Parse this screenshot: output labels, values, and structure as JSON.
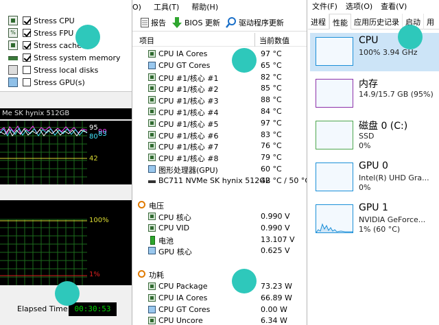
{
  "stress": {
    "items": [
      {
        "label": "Stress CPU",
        "checked": true,
        "icon": "cpu-chip-icon"
      },
      {
        "label": "Stress FPU",
        "checked": true,
        "icon": "fpu-icon"
      },
      {
        "label": "Stress cache",
        "checked": true,
        "icon": "cache-icon"
      },
      {
        "label": "Stress system memory",
        "checked": true,
        "icon": "memory-icon"
      },
      {
        "label": "Stress local disks",
        "checked": false,
        "icon": "disk-icon"
      },
      {
        "label": "Stress GPU(s)",
        "checked": false,
        "icon": "monitor-icon"
      }
    ],
    "graph_title": "Me SK hynix 512GB",
    "graph1": {
      "labels": [
        "95",
        "90",
        "80",
        "83",
        "42"
      ]
    },
    "graph2": {
      "top_label": "100%",
      "bottom_label": "1%"
    },
    "elapsed_label": "Elapsed Time:",
    "elapsed_value": "00:30:53"
  },
  "hw": {
    "menu": [
      "O)",
      "工具(T)",
      "帮助(H)"
    ],
    "toolbar": {
      "report": "报告",
      "bios": "BIOS 更新",
      "driver": "驱动程序更新"
    },
    "columns": {
      "item": "项目",
      "value": "当前数值"
    },
    "rows": [
      {
        "name": "CPU IA Cores",
        "value": "97 °C",
        "icon": "chip"
      },
      {
        "name": "CPU GT Cores",
        "value": "65 °C",
        "icon": "mon"
      },
      {
        "name": "CPU #1/核心 #1",
        "value": "82 °C",
        "icon": "chip"
      },
      {
        "name": "CPU #1/核心 #2",
        "value": "85 °C",
        "icon": "chip"
      },
      {
        "name": "CPU #1/核心 #3",
        "value": "88 °C",
        "icon": "chip"
      },
      {
        "name": "CPU #1/核心 #4",
        "value": "84 °C",
        "icon": "chip"
      },
      {
        "name": "CPU #1/核心 #5",
        "value": "97 °C",
        "icon": "chip"
      },
      {
        "name": "CPU #1/核心 #6",
        "value": "83 °C",
        "icon": "chip"
      },
      {
        "name": "CPU #1/核心 #7",
        "value": "76 °C",
        "icon": "chip"
      },
      {
        "name": "CPU #1/核心 #8",
        "value": "79 °C",
        "icon": "chip"
      },
      {
        "name": "图形处理器(GPU)",
        "value": "60 °C",
        "icon": "mon"
      },
      {
        "name": "BC711 NVMe SK hynix 512GB",
        "value": "42 °C / 50 °C",
        "icon": "disk"
      }
    ],
    "voltage": {
      "title": "电压",
      "rows": [
        {
          "name": "CPU 核心",
          "value": "0.990 V",
          "icon": "chip"
        },
        {
          "name": "CPU VID",
          "value": "0.990 V",
          "icon": "chip"
        },
        {
          "name": "电池",
          "value": "13.107 V",
          "icon": "batt"
        },
        {
          "name": "GPU 核心",
          "value": "0.625 V",
          "icon": "mon"
        }
      ]
    },
    "power": {
      "title": "功耗",
      "rows": [
        {
          "name": "CPU Package",
          "value": "73.23 W",
          "icon": "chip"
        },
        {
          "name": "CPU IA Cores",
          "value": "66.89 W",
          "icon": "chip"
        },
        {
          "name": "CPU GT Cores",
          "value": "0.00 W",
          "icon": "mon"
        },
        {
          "name": "CPU Uncore",
          "value": "6.34 W",
          "icon": "chip"
        }
      ]
    }
  },
  "tm": {
    "menu": [
      "文件(F)",
      "选项(O)",
      "查看(V)"
    ],
    "tabs": [
      "进程",
      "性能",
      "应用历史记录",
      "启动",
      "用"
    ],
    "active_tab": 1,
    "items": [
      {
        "title": "CPU",
        "line2": "100%  3.94 GHz",
        "line3": "",
        "color": "#1a8fd8"
      },
      {
        "title": "内存",
        "line2": "14.9/15.7 GB (95%)",
        "line3": "",
        "color": "#8b2fa8"
      },
      {
        "title": "磁盘 0 (C:)",
        "line2": "SSD",
        "line3": "0%",
        "color": "#4ca64c"
      },
      {
        "title": "GPU 0",
        "line2": "Intel(R) UHD Gra...",
        "line3": "0%",
        "color": "#1a8fd8"
      },
      {
        "title": "GPU 1",
        "line2": "NVIDIA GeForce...",
        "line3": "1% (60 °C)",
        "color": "#1a8fd8"
      }
    ]
  }
}
